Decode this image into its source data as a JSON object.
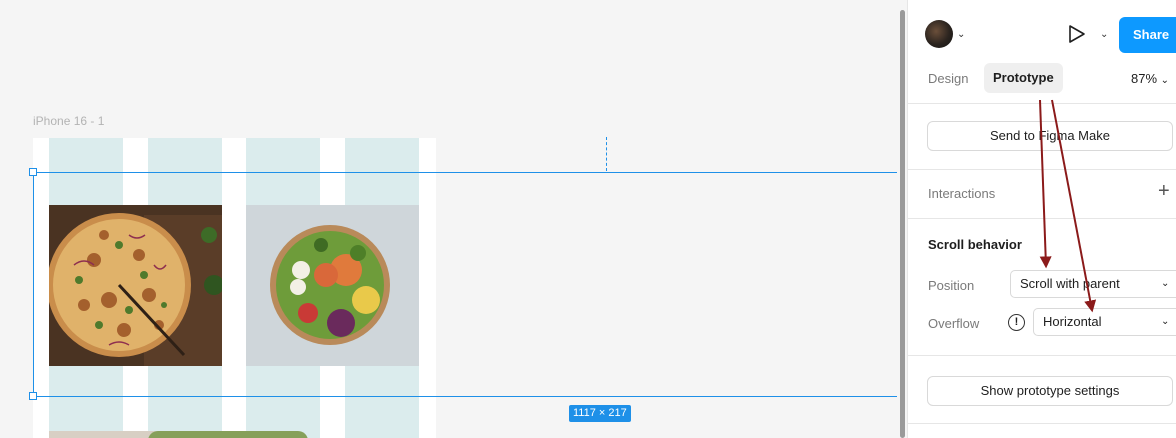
{
  "canvas": {
    "frame_label": "iPhone 16 - 1",
    "size_badge": "1117 × 217"
  },
  "panel": {
    "share_label": "Share",
    "tabs": [
      {
        "label": "Design"
      },
      {
        "label": "Prototype"
      }
    ],
    "zoom": "87%",
    "send_button": "Send to Figma Make",
    "interactions_label": "Interactions",
    "scroll_behavior": {
      "title": "Scroll behavior",
      "position_label": "Position",
      "position_value": "Scroll with parent",
      "overflow_label": "Overflow",
      "overflow_value": "Horizontal"
    },
    "show_settings_button": "Show prototype settings"
  },
  "colors": {
    "accent": "#0d99ff",
    "selection": "#1e90e8",
    "layout_grid": "#dbeced",
    "annotation_arrow": "#8b1a1a"
  },
  "icons": [
    "avatar",
    "chevron-down-icon",
    "play-icon",
    "plus-icon",
    "info-icon"
  ]
}
